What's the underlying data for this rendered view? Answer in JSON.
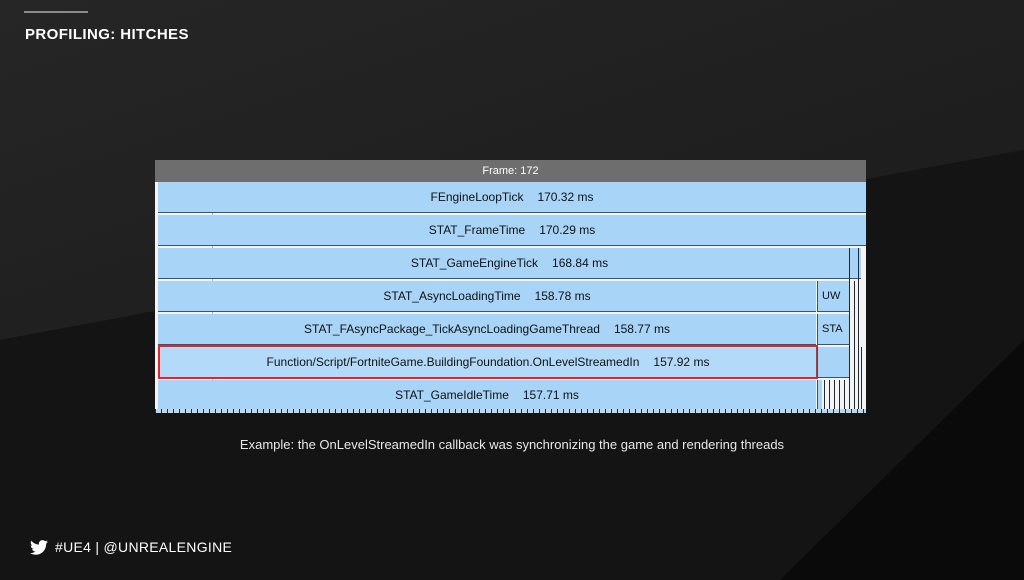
{
  "slide": {
    "title": "PROFILING: HITCHES",
    "caption": "Example: the OnLevelStreamedIn callback was synchronizing the game and rendering threads",
    "footer": "#UE4 | @UNREALENGINE"
  },
  "profiler": {
    "frame_label": "Frame: 172",
    "rows": [
      {
        "name": "FEngineLoopTick",
        "time": "170.32 ms"
      },
      {
        "name": "STAT_FrameTime",
        "time": "170.29 ms"
      },
      {
        "name": "STAT_GameEngineTick",
        "time": "168.84 ms"
      },
      {
        "name": "STAT_AsyncLoadingTime",
        "time": "158.78 ms"
      },
      {
        "name": "STAT_FAsyncPackage_TickAsyncLoadingGameThread",
        "time": "158.77 ms"
      },
      {
        "name": "Function/Script/FortniteGame.BuildingFoundation.OnLevelStreamedIn",
        "time": "157.92 ms"
      },
      {
        "name": "STAT_GameIdleTime",
        "time": "157.71 ms"
      }
    ],
    "side_labels": [
      "UW",
      "STA"
    ]
  },
  "colors": {
    "bar_fill": "#a8d4f7",
    "highlight_border": "#e0252a",
    "header_fill": "#6e6e6e",
    "background": "#111111"
  }
}
